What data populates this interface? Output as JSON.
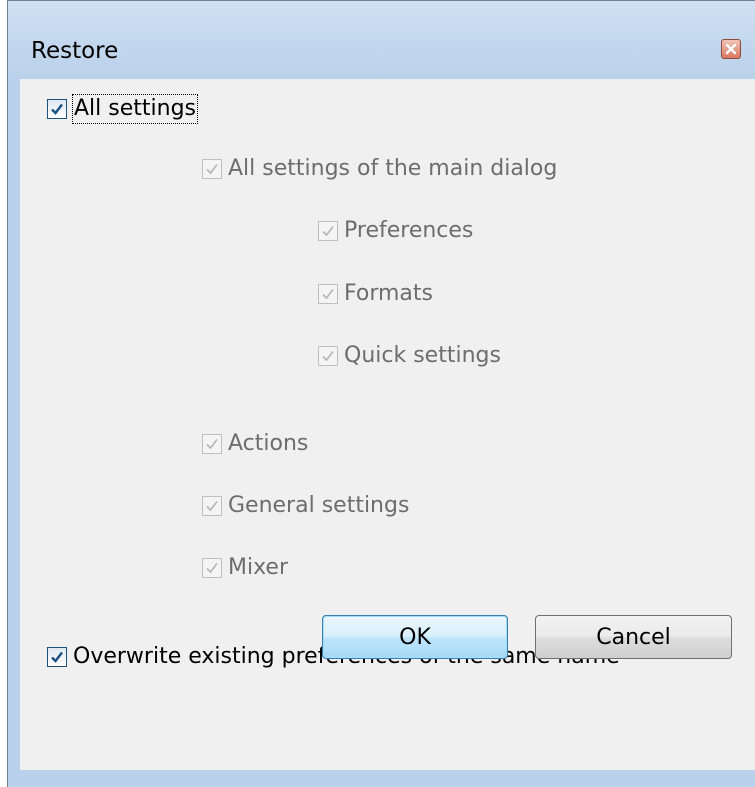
{
  "window": {
    "title": "Restore",
    "close_icon": "close-icon"
  },
  "options": {
    "all_settings": {
      "label": "All settings",
      "checked": true,
      "enabled": true
    },
    "main_dialog": {
      "label": "All settings of the main dialog",
      "checked": true,
      "enabled": false
    },
    "preferences": {
      "label": "Preferences",
      "checked": true,
      "enabled": false
    },
    "formats": {
      "label": "Formats",
      "checked": true,
      "enabled": false
    },
    "quick_settings": {
      "label": "Quick settings",
      "checked": true,
      "enabled": false
    },
    "actions": {
      "label": "Actions",
      "checked": true,
      "enabled": false
    },
    "general_settings": {
      "label": "General settings",
      "checked": true,
      "enabled": false
    },
    "mixer": {
      "label": "Mixer",
      "checked": true,
      "enabled": false
    },
    "overwrite": {
      "label": "Overwrite existing preferences of the same name",
      "checked": true,
      "enabled": true
    }
  },
  "buttons": {
    "ok_label": "OK",
    "cancel_label": "Cancel"
  },
  "colors": {
    "titlebar": "#b9d1ea",
    "client_bg": "#f0f0f0",
    "check_enabled": "#1c5180",
    "check_disabled": "#b5b5b5",
    "default_button_border": "#3c7fb1"
  }
}
